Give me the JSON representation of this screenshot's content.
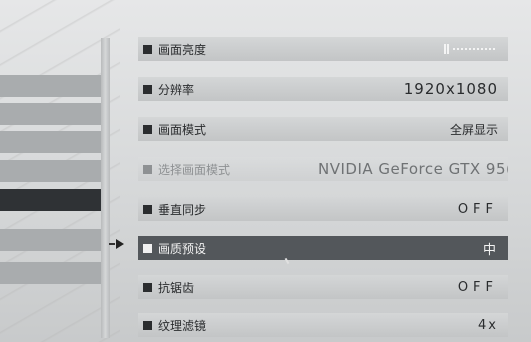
{
  "settings": [
    {
      "label": "画面亮度",
      "value": "",
      "state": "normal",
      "control": "slider"
    },
    {
      "label": "分辨率",
      "value": "1920x1080",
      "state": "normal",
      "control": "value"
    },
    {
      "label": "画面模式",
      "value": "全屏显示",
      "state": "normal",
      "control": "value"
    },
    {
      "label": "选择画面模式",
      "value": "NVIDIA GeForce GTX 95(",
      "state": "disabled",
      "control": "value"
    },
    {
      "label": "垂直同步",
      "value": "OFF",
      "state": "normal",
      "control": "value"
    },
    {
      "label": "画质预设",
      "value": "中",
      "state": "selected",
      "control": "value"
    },
    {
      "label": "抗锯齿",
      "value": "OFF",
      "state": "normal",
      "control": "value"
    },
    {
      "label": "纹理滤镜",
      "value": "4x",
      "state": "normal",
      "control": "value"
    }
  ],
  "brightness": {
    "level": 0.1
  },
  "colors": {
    "selected_row": "#53575b",
    "row": "#c8cacb",
    "active_tab": "#2f3235"
  }
}
